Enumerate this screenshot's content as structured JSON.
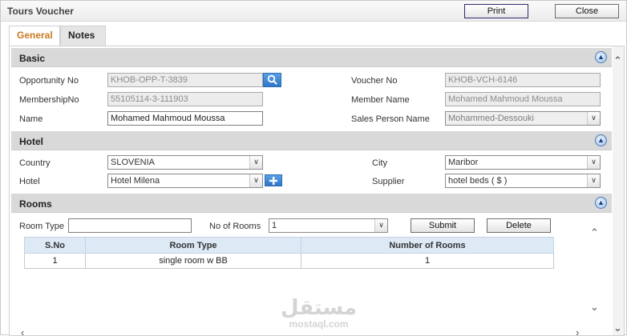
{
  "window": {
    "title": "Tours Voucher",
    "print_label": "Print",
    "close_label": "Close"
  },
  "tabs": [
    {
      "label": "General",
      "active": true
    },
    {
      "label": "Notes",
      "active": false
    }
  ],
  "basic": {
    "title": "Basic",
    "opportunity_label": "Opportunity No",
    "opportunity_value": "KHOB-OPP-T-3839",
    "voucher_label": "Voucher No",
    "voucher_value": "KHOB-VCH-6146",
    "membership_label": "MembershipNo",
    "membership_value": "55105114-3-111903",
    "member_name_label": "Member Name",
    "member_name_value": "Mohamed Mahmoud Moussa",
    "name_label": "Name",
    "name_value": "Mohamed Mahmoud Moussa",
    "sales_label": "Sales Person Name",
    "sales_value": "Mohammed-Dessouki"
  },
  "hotel": {
    "title": "Hotel",
    "country_label": "Country",
    "country_value": "SLOVENIA",
    "city_label": "City",
    "city_value": "Maribor",
    "hotel_label": "Hotel",
    "hotel_value": "Hotel Milena",
    "supplier_label": "Supplier",
    "supplier_value": "hotel beds ( $ )"
  },
  "rooms": {
    "title": "Rooms",
    "room_type_label": "Room Type",
    "room_type_value": "",
    "no_rooms_label": "No of Rooms",
    "no_rooms_value": "1",
    "submit_label": "Submit",
    "delete_label": "Delete",
    "columns": [
      "S.No",
      "Room Type",
      "Number of Rooms"
    ],
    "rows": [
      [
        "1",
        "single room w BB",
        "1"
      ]
    ]
  },
  "watermark": {
    "arabic": "مستقل",
    "latin": "mostaql.com"
  },
  "colors": {
    "active_tab": "#c8781f",
    "section_bg": "#d9d9d9",
    "grid_header": "#dde9f5"
  }
}
